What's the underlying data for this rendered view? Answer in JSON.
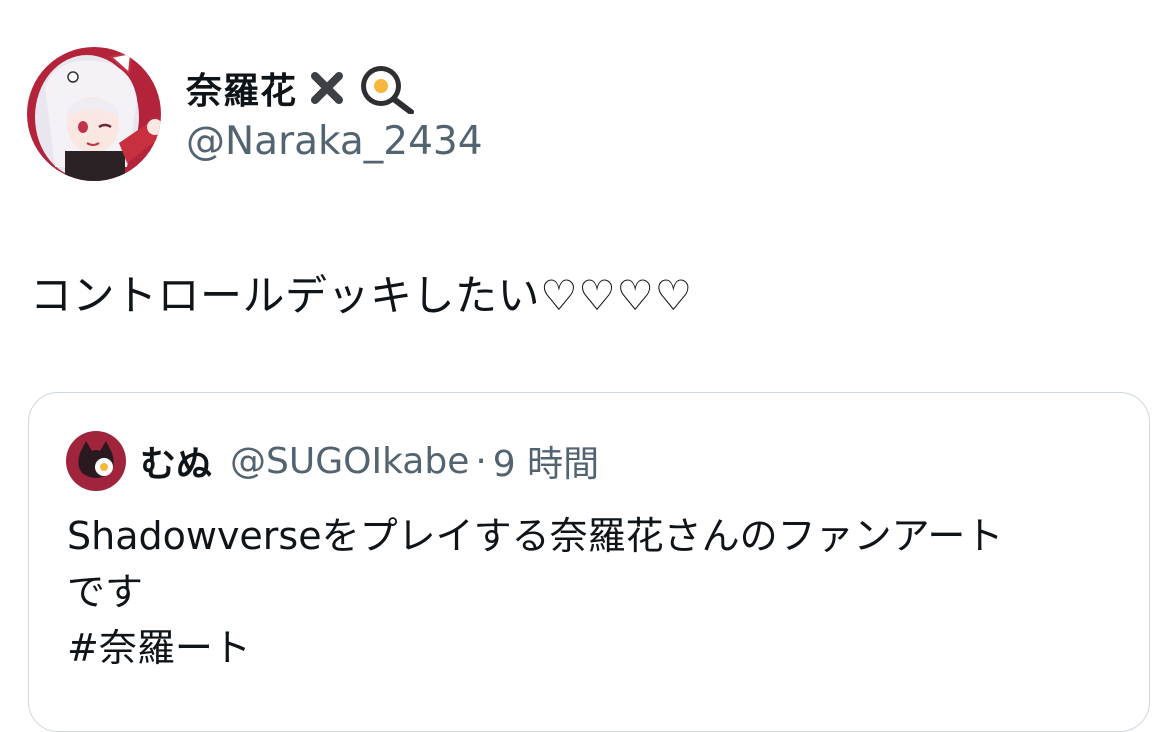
{
  "author": {
    "name": "奈羅花",
    "handle": "@Naraka_2434",
    "avatar_icon": "anime-girl-avatar",
    "name_emojis": [
      "cross-mark-icon",
      "frying-pan-egg-icon"
    ]
  },
  "tweet": {
    "text": "コントロールデッキしたい♡♡♡♡"
  },
  "quote": {
    "name": "むぬ",
    "handle": "@SUGOIkabe",
    "separator": "·",
    "time": "9 時間",
    "text_line1": "Shadowverseをプレイする奈羅花さんのファンアート",
    "text_line2": "です",
    "hashtag": "#奈羅ート"
  },
  "colors": {
    "text": "#0f1419",
    "secondary": "#536471",
    "border": "#cfd9de"
  }
}
